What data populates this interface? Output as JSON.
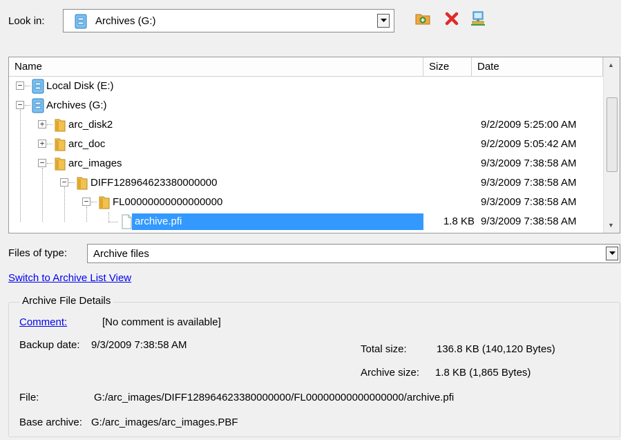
{
  "look_in": {
    "label": "Look in:",
    "value": "Archives (G:)",
    "icon": "drive-icon"
  },
  "toolbar": {
    "buttons": [
      {
        "name": "add-location-button",
        "icon": "folder-add-icon"
      },
      {
        "name": "delete-button",
        "icon": "red-x-icon"
      },
      {
        "name": "network-button",
        "icon": "network-computer-icon"
      }
    ]
  },
  "list": {
    "columns": {
      "name": "Name",
      "size": "Size",
      "date": "Date"
    },
    "rows": [
      {
        "name": "Local Disk (E:)",
        "size": "",
        "date": "",
        "level": 0,
        "expander": "-",
        "icon": "drive-icon",
        "selected": false
      },
      {
        "name": "Archives (G:)",
        "size": "",
        "date": "",
        "level": 0,
        "expander": "-",
        "icon": "drive-icon",
        "selected": false
      },
      {
        "name": "arc_disk2",
        "size": "",
        "date": "9/2/2009 5:25:00 AM",
        "level": 1,
        "expander": "+",
        "icon": "folder-icon",
        "selected": false
      },
      {
        "name": "arc_doc",
        "size": "",
        "date": "9/2/2009 5:05:42 AM",
        "level": 1,
        "expander": "+",
        "icon": "folder-icon",
        "selected": false
      },
      {
        "name": "arc_images",
        "size": "",
        "date": "9/3/2009 7:38:58 AM",
        "level": 1,
        "expander": "-",
        "icon": "folder-icon",
        "selected": false
      },
      {
        "name": "DIFF128964623380000000",
        "size": "",
        "date": "9/3/2009 7:38:58 AM",
        "level": 2,
        "expander": "-",
        "icon": "folder-icon",
        "selected": false
      },
      {
        "name": "FL00000000000000000",
        "size": "",
        "date": "9/3/2009 7:38:58 AM",
        "level": 3,
        "expander": "-",
        "icon": "folder-icon",
        "selected": false
      },
      {
        "name": "archive.pfi",
        "size": "1.8 KB",
        "date": "9/3/2009 7:38:58 AM",
        "level": 4,
        "expander": "",
        "icon": "file-icon",
        "selected": true
      }
    ]
  },
  "files_of_type": {
    "label": "Files of type:",
    "value": "Archive files"
  },
  "switch_link": "Switch to Archive List View",
  "details": {
    "title": "Archive File Details",
    "comment_label": "Comment:",
    "comment_value": "[No comment is available]",
    "backup_date_label": "Backup date:",
    "backup_date_value": "9/3/2009 7:38:58 AM",
    "total_size_label": "Total size:",
    "total_size_value": "136.8 KB (140,120 Bytes)",
    "archive_size_label": "Archive size:",
    "archive_size_value": "1.8 KB (1,865 Bytes)",
    "file_label": "File:",
    "file_value": "G:/arc_images/DIFF128964623380000000/FL00000000000000000/archive.pfi",
    "base_label": "Base archive:",
    "base_value": "G:/arc_images/arc_images.PBF"
  },
  "colors": {
    "selection": "#3399ff",
    "link": "#0000ee",
    "folder": "#e8b84a",
    "drive": "#4a9fe0"
  }
}
